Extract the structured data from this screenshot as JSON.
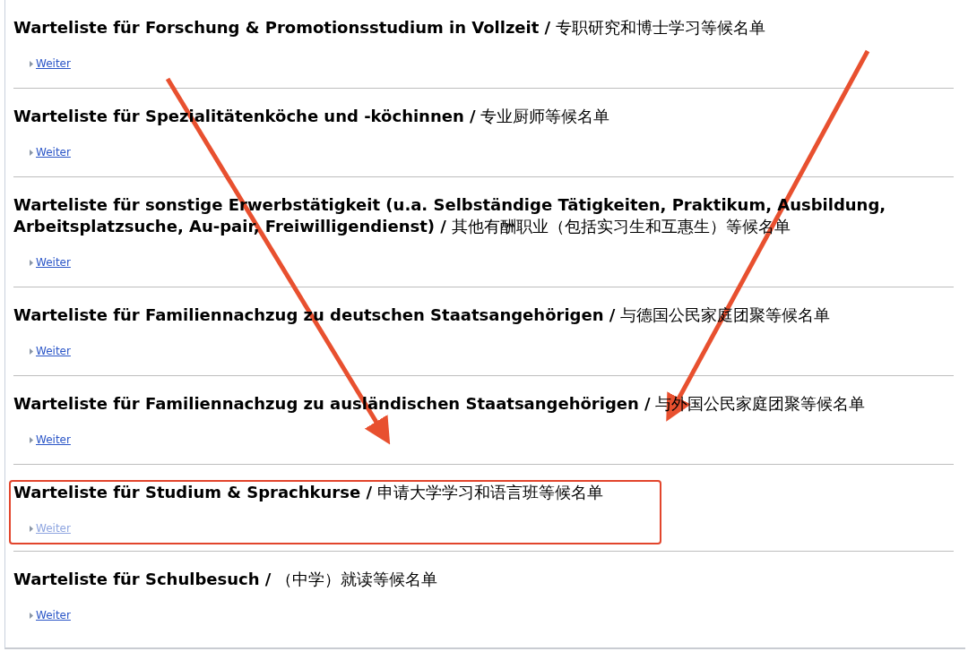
{
  "sections": [
    {
      "heading": "**Warteliste für Forschung & Promotionsstudium in Vollzeit /** 专职研究和博士学习等候名单",
      "link": "Weiter",
      "highlighted": false
    },
    {
      "heading": "**Warteliste für Spezialitätenköche und -köchinnen /** 专业厨师等候名单",
      "link": "Weiter",
      "highlighted": false
    },
    {
      "heading": "**Warteliste für sonstige Erwerbstätigkeit (u.a. Selbständige Tätigkeiten, Praktikum, Ausbildung, Arbeitsplatzsuche, Au-pair, Freiwilligendienst) /** 其他有酬职业（包括实习生和互惠生）等候名单",
      "link": "Weiter",
      "highlighted": false
    },
    {
      "heading": "**Warteliste für Familiennachzug zu deutschen Staatsangehörigen /** 与德国公民家庭团聚等候名单",
      "link": "Weiter",
      "highlighted": false
    },
    {
      "heading": "**Warteliste für Familiennachzug zu ausländischen Staatsangehörigen /** 与外国公民家庭团聚等候名单",
      "link": "Weiter",
      "highlighted": false
    },
    {
      "heading": "**Warteliste für Studium & Sprachkurse /** 申请大学学习和语言班等候名单",
      "link": "Weiter",
      "highlighted": true
    },
    {
      "heading": "**Warteliste für Schulbesuch /** （中学）就读等候名单",
      "link": "Weiter",
      "highlighted": false
    }
  ]
}
